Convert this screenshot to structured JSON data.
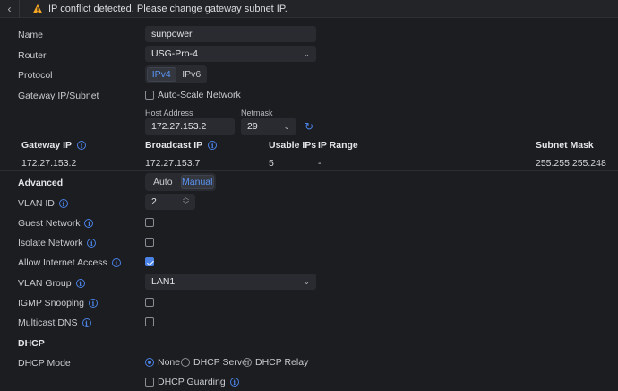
{
  "alert": {
    "text": "IP conflict detected. Please change gateway subnet IP."
  },
  "name": {
    "label": "Name",
    "value": "sunpower"
  },
  "router": {
    "label": "Router",
    "value": "USG-Pro-4"
  },
  "protocol": {
    "label": "Protocol",
    "options": [
      "IPv4",
      "IPv6"
    ],
    "selected": "IPv4"
  },
  "gateway": {
    "label": "Gateway IP/Subnet",
    "auto_scale_label": "Auto-Scale Network",
    "auto_scale_checked": false,
    "host_label": "Host Address",
    "host_value": "172.27.153.2",
    "netmask_label": "Netmask",
    "netmask_value": "29"
  },
  "table": {
    "headers": [
      "Gateway IP",
      "Broadcast IP",
      "Usable IPs",
      "IP Range",
      "Subnet Mask"
    ],
    "row": [
      "172.27.153.2",
      "172.27.153.7",
      "5",
      "-",
      "255.255.255.248"
    ]
  },
  "advanced": {
    "label": "Advanced",
    "options": [
      "Auto",
      "Manual"
    ],
    "selected": "Manual"
  },
  "vlan_id": {
    "label": "VLAN ID",
    "value": "2"
  },
  "guest_network": {
    "label": "Guest Network",
    "checked": false
  },
  "isolate_network": {
    "label": "Isolate Network",
    "checked": false
  },
  "allow_internet": {
    "label": "Allow Internet Access",
    "checked": true
  },
  "vlan_group": {
    "label": "VLAN Group",
    "value": "LAN1"
  },
  "igmp": {
    "label": "IGMP Snooping",
    "checked": false
  },
  "mdns": {
    "label": "Multicast DNS",
    "checked": false
  },
  "dhcp": {
    "section": "DHCP",
    "mode_label": "DHCP Mode",
    "modes": [
      "None",
      "DHCP Server",
      "DHCP Relay"
    ],
    "selected": "None",
    "guarding_label": "DHCP Guarding",
    "guarding_checked": false
  },
  "colors": {
    "accent": "#4a82e6",
    "warning": "#f5a623",
    "background": "#1c1d20"
  }
}
